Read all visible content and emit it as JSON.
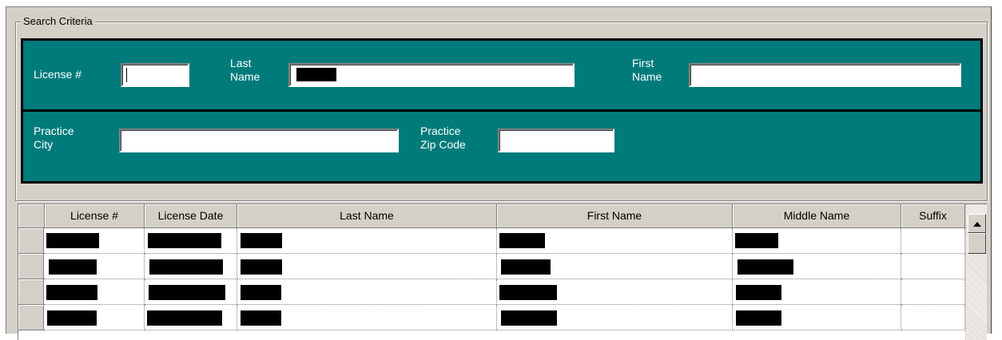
{
  "search_criteria": {
    "legend": "Search Criteria",
    "license_label": "License #",
    "last_name_label": "Last\nName",
    "first_name_label": "First\nName",
    "practice_city_label": "Practice\nCity",
    "practice_zip_label": "Practice\nZip Code",
    "license_value": "",
    "last_name_value": "",
    "first_name_value": "",
    "practice_city_value": "",
    "practice_zip_value": ""
  },
  "results": {
    "columns": [
      "License #",
      "License Date",
      "Last Name",
      "First Name",
      "Middle Name",
      "Suffix"
    ],
    "row_count": 4
  },
  "colors": {
    "panel_teal": "#007b7b",
    "window_bg": "#d4d0c8"
  },
  "icons": {
    "scroll_up": "up-arrow-icon"
  }
}
